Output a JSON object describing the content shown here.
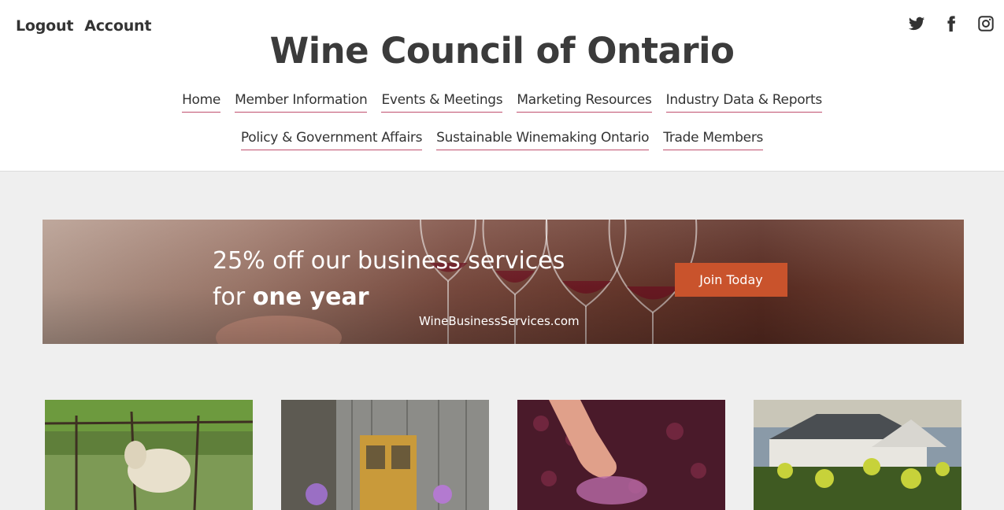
{
  "account": {
    "logout": "Logout",
    "account": "Account"
  },
  "social": [
    "twitter-icon",
    "facebook-icon",
    "instagram-icon"
  ],
  "site_title": "Wine Council of Ontario",
  "nav": {
    "row1": [
      "Home",
      "Member Information",
      "Events & Meetings",
      "Marketing Resources",
      "Industry Data & Reports"
    ],
    "row2": [
      "Policy & Government Affairs",
      "Sustainable Winemaking Ontario",
      "Trade Members"
    ]
  },
  "banner": {
    "line1": "25% off our business services",
    "line2_prefix": "for ",
    "line2_bold": "one year",
    "url": "WineBusinessServices.com",
    "cta": "Join Today"
  },
  "cards": [
    "sheep in vineyard photo",
    "barn door photo",
    "grape crushing hand photo",
    "winery building photo"
  ],
  "colors": {
    "accent_underline": "#c0506e",
    "cta": "#c9532c",
    "text": "#333333"
  }
}
